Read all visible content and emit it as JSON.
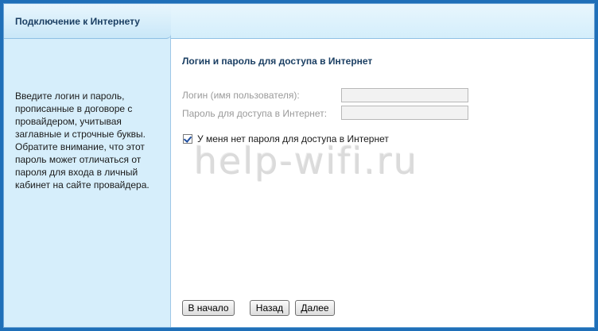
{
  "sidebar": {
    "tab_title": "Подключение к Интернету",
    "help_text": "Введите логин и пароль, прописанные в договоре с провайдером, учитывая заглавные и строчные буквы. Обратите внимание, что этот пароль может отличаться от пароля для входа в личный кабинет на сайте провайдера."
  },
  "main": {
    "section_title": "Логин и пароль для доступа в Интернет",
    "login": {
      "label": "Логин (имя пользователя):",
      "value": ""
    },
    "password": {
      "label": "Пароль для доступа в Интернет:",
      "value": ""
    },
    "no_password": {
      "label": "У меня нет пароля для доступа в Интернет",
      "checked": true
    },
    "watermark": "help-wifi.ru"
  },
  "buttons": {
    "start": "В начало",
    "back": "Назад",
    "next": "Далее"
  },
  "colors": {
    "frame_border": "#1f6fb8",
    "sidebar_bg": "#d6eefb",
    "title_color": "#1b3f63"
  }
}
